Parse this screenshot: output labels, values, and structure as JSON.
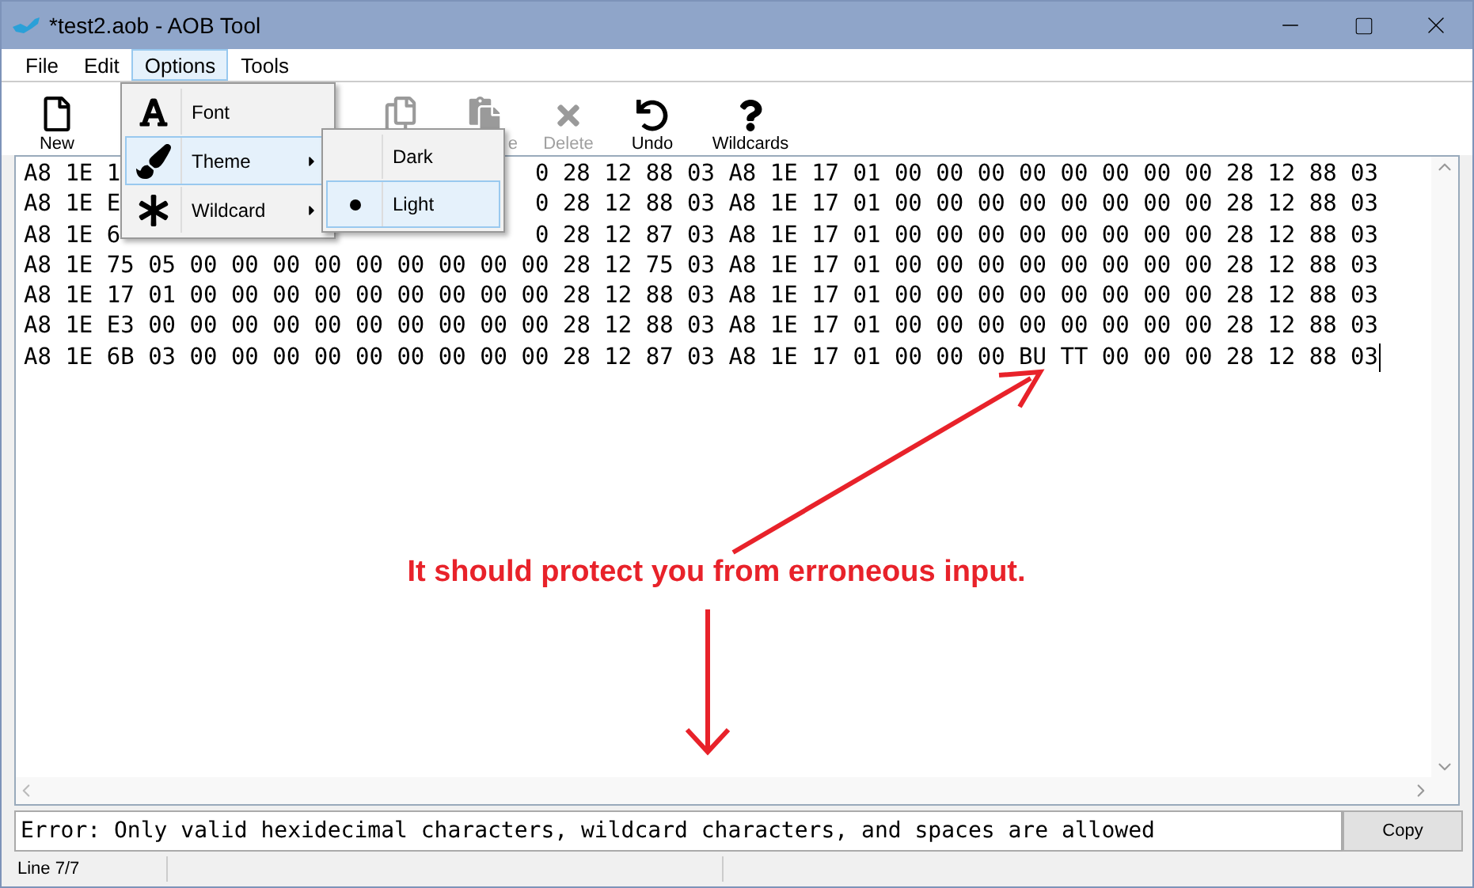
{
  "window": {
    "title": "*test2.aob - AOB Tool"
  },
  "menu_bar": [
    {
      "label": "File",
      "selected": false
    },
    {
      "label": "Edit",
      "selected": false
    },
    {
      "label": "Options",
      "selected": true
    },
    {
      "label": "Tools",
      "selected": false
    }
  ],
  "toolbar": [
    {
      "kind": "new",
      "label": "New",
      "disabled": false
    },
    {
      "kind": "copy",
      "disabled": true
    },
    {
      "kind": "paste",
      "label": "e",
      "disabled": true
    },
    {
      "kind": "delete",
      "label": "Delete",
      "disabled": true
    },
    {
      "kind": "undo",
      "label": "Undo",
      "disabled": false
    },
    {
      "kind": "wildcards",
      "label": "Wildcards",
      "disabled": false
    }
  ],
  "options_menu": {
    "items": [
      {
        "kind": "font",
        "label": "Font",
        "highlighted": false,
        "has_submenu": false
      },
      {
        "kind": "theme",
        "label": "Theme",
        "highlighted": true,
        "has_submenu": true
      },
      {
        "kind": "wildcard",
        "label": "Wildcard",
        "highlighted": false,
        "has_submenu": true
      }
    ],
    "theme_submenu": [
      {
        "label": "Dark",
        "selected": false
      },
      {
        "label": "Light",
        "selected": true
      }
    ]
  },
  "editor": {
    "rows": [
      {
        "left": "A8 1E 1",
        "right": "0 28 12 88 03 A8 1E 17 01 00 00 00 00 00 00 00 00 28 12 88 03"
      },
      {
        "left": "A8 1E E",
        "right": "0 28 12 88 03 A8 1E 17 01 00 00 00 00 00 00 00 00 28 12 88 03"
      },
      {
        "left": "A8 1E 6",
        "right": "0 28 12 87 03 A8 1E 17 01 00 00 00 00 00 00 00 00 28 12 88 03"
      },
      {
        "text": "A8 1E 75 05 00 00 00 00 00 00 00 00 00 28 12 75 03 A8 1E 17 01 00 00 00 00 00 00 00 00 28 12 88 03"
      },
      {
        "text": "A8 1E 17 01 00 00 00 00 00 00 00 00 00 28 12 88 03 A8 1E 17 01 00 00 00 00 00 00 00 00 28 12 88 03"
      },
      {
        "text": "A8 1E E3 00 00 00 00 00 00 00 00 00 00 28 12 88 03 A8 1E 17 01 00 00 00 00 00 00 00 00 28 12 88 03"
      },
      {
        "text": "A8 1E 6B 03 00 00 00 00 00 00 00 00 00 28 12 87 03 A8 1E 17 01 00 00 00 BU TT 00 00 00 28 12 88 03",
        "caret": true
      }
    ]
  },
  "annotation": {
    "text": "It should protect you from erroneous input."
  },
  "error_bar": {
    "message": "Error: Only valid hexidecimal characters, wildcard characters, and spaces are allowed",
    "button": "Copy"
  },
  "status_bar": {
    "line": "Line 7/7"
  }
}
